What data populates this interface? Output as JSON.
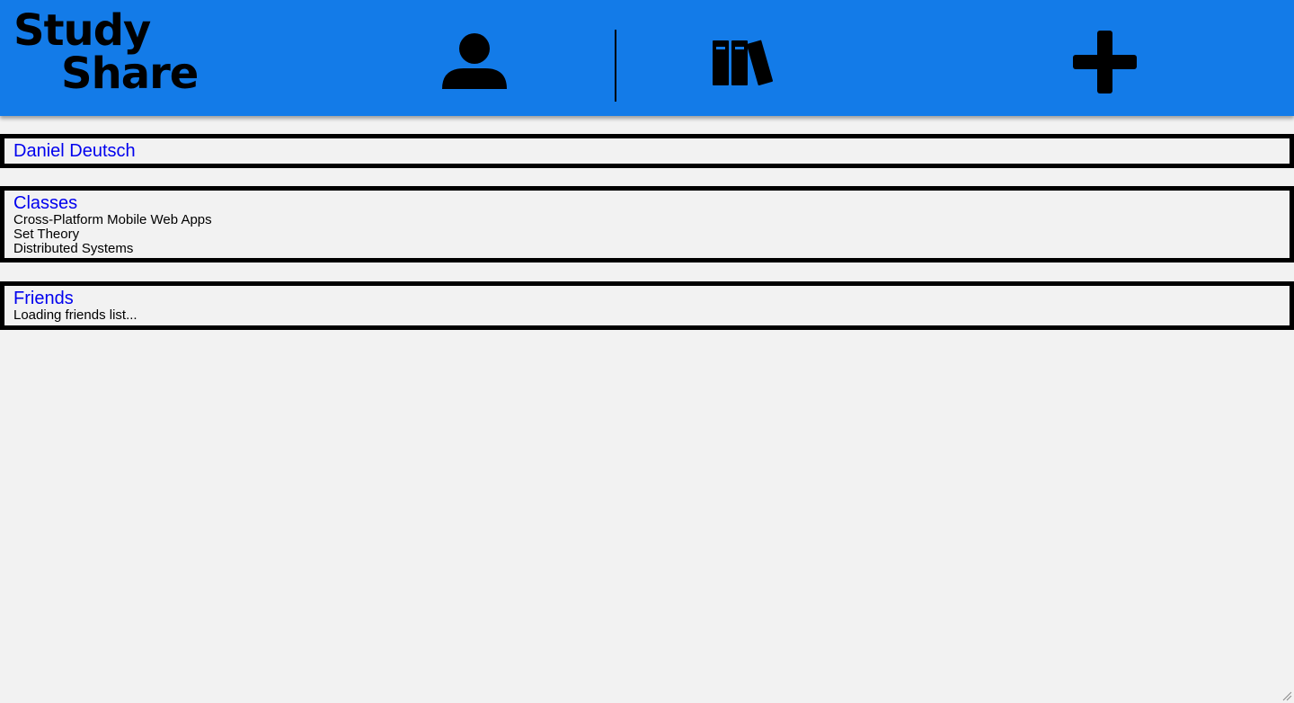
{
  "header": {
    "logo_line1": "Study",
    "logo_line2": "Share",
    "background": "#137be8",
    "nav": [
      {
        "name": "profile",
        "icon": "user-icon"
      },
      {
        "name": "library",
        "icon": "books-icon"
      },
      {
        "name": "add",
        "icon": "plus-icon"
      }
    ]
  },
  "profile": {
    "name": "Daniel Deutsch"
  },
  "classes": {
    "title": "Classes",
    "items": [
      "Cross-Platform Mobile Web Apps",
      "Set Theory",
      "Distributed Systems"
    ]
  },
  "friends": {
    "title": "Friends",
    "status": "Loading friends list..."
  },
  "colors": {
    "link": "#0000ee",
    "page_bg": "#f2f2f2",
    "border": "#000000"
  }
}
